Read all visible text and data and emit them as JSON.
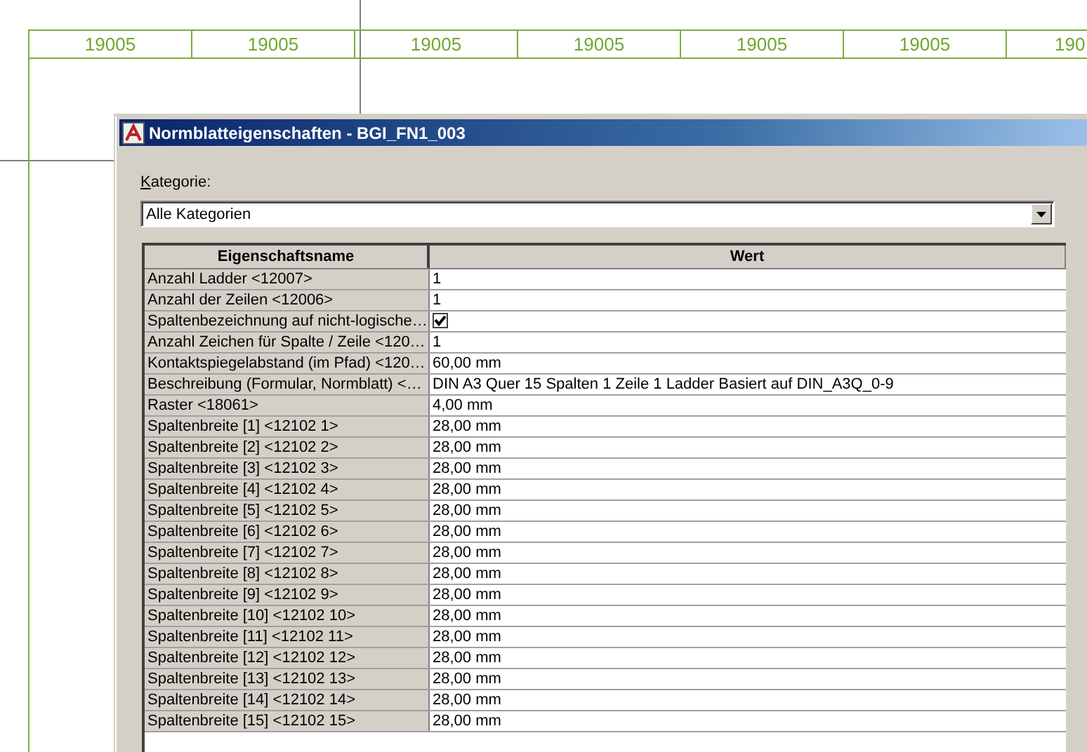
{
  "drawing": {
    "column_labels": [
      "19005",
      "19005",
      "19005",
      "19005",
      "19005",
      "19005",
      "190"
    ]
  },
  "dialog": {
    "title": "Normblatteigenschaften - BGI_FN1_003",
    "category_label": "Kategorie:",
    "category_value": "Alle Kategorien",
    "table": {
      "columns": [
        "Eigenschaftsname",
        "Wert"
      ],
      "rows": [
        {
          "name": "Anzahl Ladder <12007>",
          "kind": "text",
          "value": "1"
        },
        {
          "name": "Anzahl der Zeilen <12006>",
          "kind": "text",
          "value": "1"
        },
        {
          "name": "Spaltenbezeichnung auf nicht-logische…",
          "kind": "checkbox",
          "checked": true
        },
        {
          "name": "Anzahl Zeichen für Spalte / Zeile <120…",
          "kind": "text",
          "value": "1"
        },
        {
          "name": "Kontaktspiegelabstand (im Pfad) <120…",
          "kind": "text",
          "value": "60,00 mm"
        },
        {
          "name": "Beschreibung (Formular, Normblatt) <…",
          "kind": "text",
          "value": "DIN A3 Quer 15 Spalten 1 Zeile 1 Ladder Basiert auf DIN_A3Q_0-9"
        },
        {
          "name": "Raster <18061>",
          "kind": "text",
          "value": "4,00 mm"
        },
        {
          "name": "Spaltenbreite [1] <12102 1>",
          "kind": "text",
          "value": "28,00 mm"
        },
        {
          "name": "Spaltenbreite [2] <12102 2>",
          "kind": "text",
          "value": "28,00 mm"
        },
        {
          "name": "Spaltenbreite [3] <12102 3>",
          "kind": "text",
          "value": "28,00 mm"
        },
        {
          "name": "Spaltenbreite [4] <12102 4>",
          "kind": "text",
          "value": "28,00 mm"
        },
        {
          "name": "Spaltenbreite [5] <12102 5>",
          "kind": "text",
          "value": "28,00 mm"
        },
        {
          "name": "Spaltenbreite [6] <12102 6>",
          "kind": "text",
          "value": "28,00 mm"
        },
        {
          "name": "Spaltenbreite [7] <12102 7>",
          "kind": "text",
          "value": "28,00 mm"
        },
        {
          "name": "Spaltenbreite [8] <12102 8>",
          "kind": "text",
          "value": "28,00 mm"
        },
        {
          "name": "Spaltenbreite [9] <12102 9>",
          "kind": "text",
          "value": "28,00 mm"
        },
        {
          "name": "Spaltenbreite [10] <12102 10>",
          "kind": "text",
          "value": "28,00 mm"
        },
        {
          "name": "Spaltenbreite [11] <12102 11>",
          "kind": "text",
          "value": "28,00 mm"
        },
        {
          "name": "Spaltenbreite [12] <12102 12>",
          "kind": "text",
          "value": "28,00 mm"
        },
        {
          "name": "Spaltenbreite [13] <12102 13>",
          "kind": "text",
          "value": "28,00 mm"
        },
        {
          "name": "Spaltenbreite [14] <12102 14>",
          "kind": "text",
          "value": "28,00 mm"
        },
        {
          "name": "Spaltenbreite [15] <12102 15>",
          "kind": "text",
          "value": "28,00 mm"
        }
      ]
    }
  }
}
